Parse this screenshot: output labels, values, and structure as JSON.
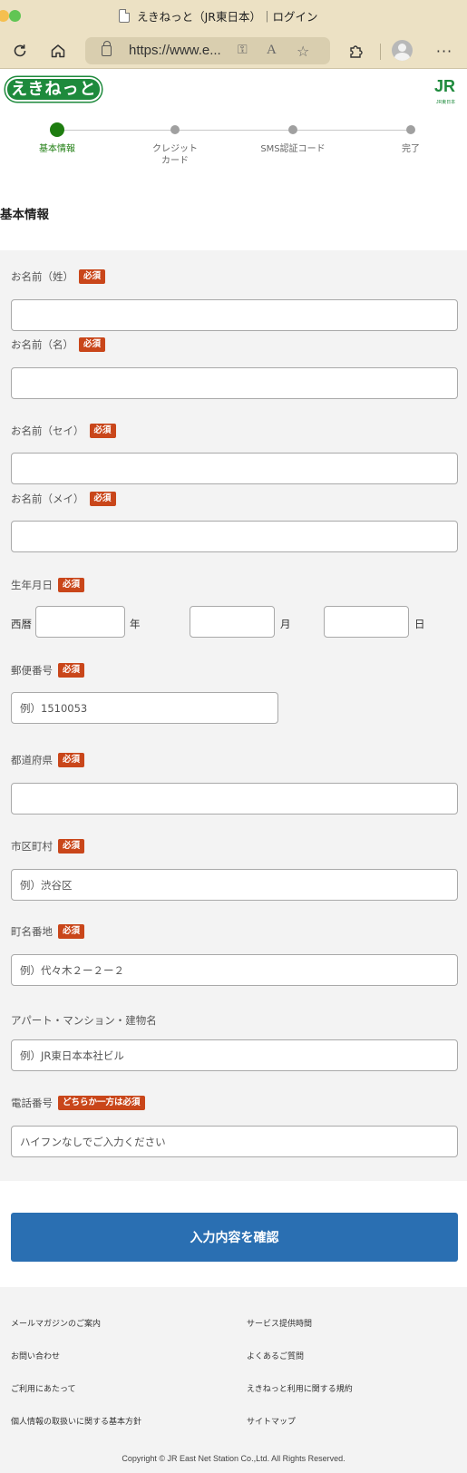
{
  "browser": {
    "tab_title": "えきねっと（JR東日本）｜ログイン",
    "url": "https://www.e..."
  },
  "header": {
    "logo_text": "えきねっと",
    "jr_logo_text": "JR",
    "jr_logo_sub": "JR東日本"
  },
  "stepper": {
    "steps": [
      {
        "label": "基本情報",
        "active": true
      },
      {
        "label": "クレジット\nカード",
        "active": false
      },
      {
        "label": "SMS認証コード",
        "active": false
      },
      {
        "label": "完了",
        "active": false
      }
    ]
  },
  "section_title": "基本情報",
  "required_badge": "必須",
  "form": {
    "last_name": {
      "label": "お名前（姓）",
      "value": "",
      "placeholder": ""
    },
    "first_name": {
      "label": "お名前（名）",
      "value": "",
      "placeholder": ""
    },
    "last_name_kana": {
      "label": "お名前（セイ）",
      "value": "",
      "placeholder": ""
    },
    "first_name_kana": {
      "label": "お名前（メイ）",
      "value": "",
      "placeholder": ""
    },
    "birthdate": {
      "label": "生年月日",
      "era_label": "西暦",
      "year_unit": "年",
      "month_unit": "月",
      "day_unit": "日"
    },
    "postal_code": {
      "label": "郵便番号",
      "placeholder": "例）1510053"
    },
    "prefecture": {
      "label": "都道府県",
      "value": ""
    },
    "city": {
      "label": "市区町村",
      "placeholder": "例）渋谷区"
    },
    "street": {
      "label": "町名番地",
      "placeholder": "例）代々木２ー２ー２"
    },
    "building": {
      "label": "アパート・マンション・建物名",
      "placeholder": "例）JR東日本本社ビル"
    },
    "phone": {
      "label": "電話番号",
      "badge": "どちらか一方は必須",
      "placeholder": "ハイフンなしでご入力ください"
    }
  },
  "confirm_button": "入力内容を確認",
  "footer": {
    "links": [
      "メールマガジンのご案内",
      "サービス提供時間",
      "お問い合わせ",
      "よくあるご質問",
      "ご利用にあたって",
      "えきねっと利用に関する規約",
      "個人情報の取扱いに関する基本方針",
      "サイトマップ"
    ],
    "copyright": "Copyright © JR East Net Station Co.,Ltd. All Rights Reserved."
  },
  "colors": {
    "brand_green": "#1e8a3c",
    "step_active": "#1e7d10",
    "required_badge": "#c9461a",
    "primary_button": "#2a6fb2",
    "browser_chrome": "#ece1c4"
  }
}
